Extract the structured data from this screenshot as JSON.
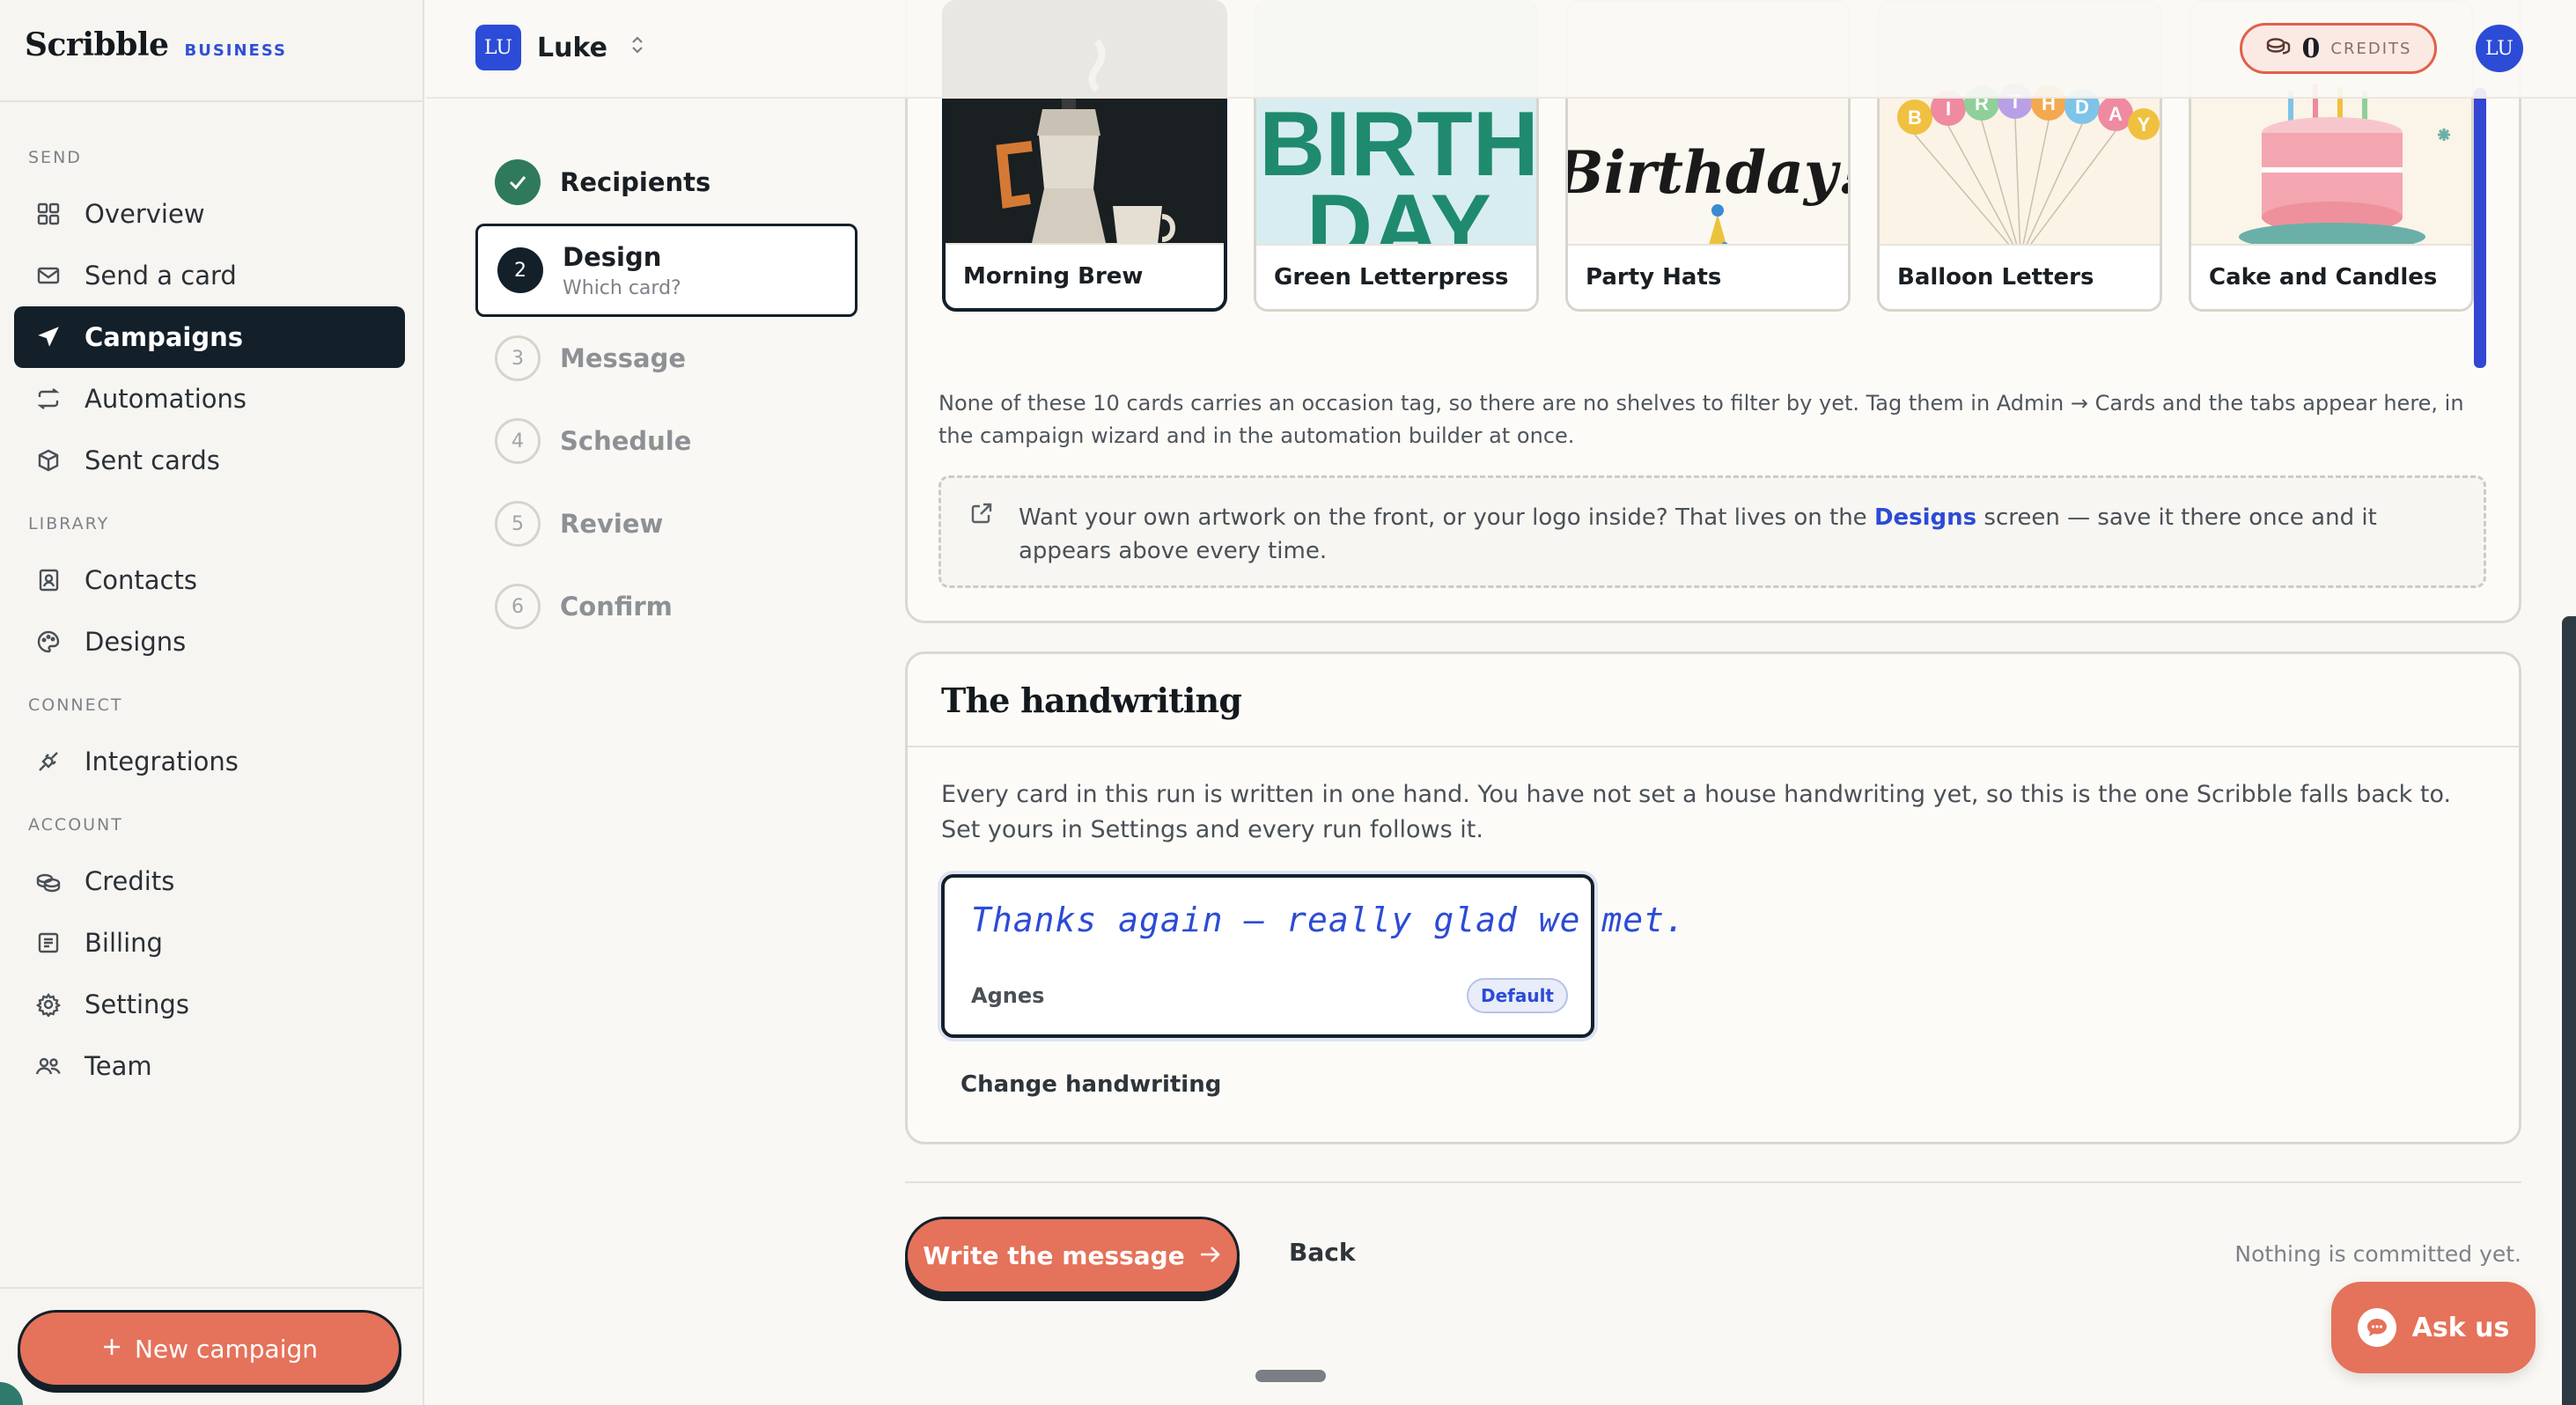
{
  "brand": {
    "name": "Scribble",
    "tag": "BUSINESS"
  },
  "sidebar": {
    "sections": [
      {
        "label": "SEND",
        "items": [
          {
            "label": "Overview",
            "icon": "grid-icon"
          },
          {
            "label": "Send a card",
            "icon": "envelope-icon"
          },
          {
            "label": "Campaigns",
            "icon": "send-icon",
            "active": true
          },
          {
            "label": "Automations",
            "icon": "repeat-icon"
          },
          {
            "label": "Sent cards",
            "icon": "box-icon"
          }
        ]
      },
      {
        "label": "LIBRARY",
        "items": [
          {
            "label": "Contacts",
            "icon": "contact-book-icon"
          },
          {
            "label": "Designs",
            "icon": "palette-icon"
          }
        ]
      },
      {
        "label": "CONNECT",
        "items": [
          {
            "label": "Integrations",
            "icon": "plug-icon"
          }
        ]
      },
      {
        "label": "ACCOUNT",
        "items": [
          {
            "label": "Credits",
            "icon": "coins-icon"
          },
          {
            "label": "Billing",
            "icon": "receipt-icon"
          },
          {
            "label": "Settings",
            "icon": "gear-icon"
          },
          {
            "label": "Team",
            "icon": "team-icon"
          }
        ]
      }
    ],
    "new_campaign_label": "New campaign"
  },
  "topbar": {
    "workspace_initials": "LU",
    "workspace_name": "Luke",
    "credits_value": "0",
    "credits_label": "CREDITS",
    "user_initials": "LU"
  },
  "stepper": {
    "steps": [
      {
        "number": "1",
        "label": "Recipients",
        "state": "done"
      },
      {
        "number": "2",
        "label": "Design",
        "sub": "Which card?",
        "state": "current"
      },
      {
        "number": "3",
        "label": "Message",
        "state": "todo"
      },
      {
        "number": "4",
        "label": "Schedule",
        "state": "todo"
      },
      {
        "number": "5",
        "label": "Review",
        "state": "todo"
      },
      {
        "number": "6",
        "label": "Confirm",
        "state": "todo"
      }
    ]
  },
  "cards": {
    "items": [
      {
        "name": "Morning Brew",
        "selected": true
      },
      {
        "name": "Green Letterpress",
        "art_text": "BIRTH DAY"
      },
      {
        "name": "Party Hats",
        "art_text": "Birthday!"
      },
      {
        "name": "Balloon Letters",
        "art_text": "BIRTHDAY"
      },
      {
        "name": "Cake and Candles"
      }
    ],
    "note": "None of these 10 cards carries an occasion tag, so there are no shelves to filter by yet. Tag them in Admin → Cards and the tabs appear here, in the campaign wizard and in the automation builder at once.",
    "designs_hint_before": "Want your own artwork on the front, or your logo inside? That lives on the ",
    "designs_link": "Designs",
    "designs_hint_after": " screen — save it there once and it appears above every time."
  },
  "handwriting": {
    "title": "The handwriting",
    "description": "Every card in this run is written in one hand. You have not set a house handwriting yet, so this is the one Scribble falls back to. Set yours in Settings and every run follows it.",
    "sample_text": "Thanks again — really glad we met.",
    "person": "Agnes",
    "badge": "Default",
    "change_label": "Change handwriting"
  },
  "footer": {
    "primary_label": "Write the message",
    "back_label": "Back",
    "commit_note": "Nothing is committed yet.",
    "ask_label": "Ask us"
  },
  "colors": {
    "accent": "#e5725a",
    "brand_blue": "#2c4bd6",
    "ink": "#13202a",
    "success": "#2f7a5a"
  }
}
